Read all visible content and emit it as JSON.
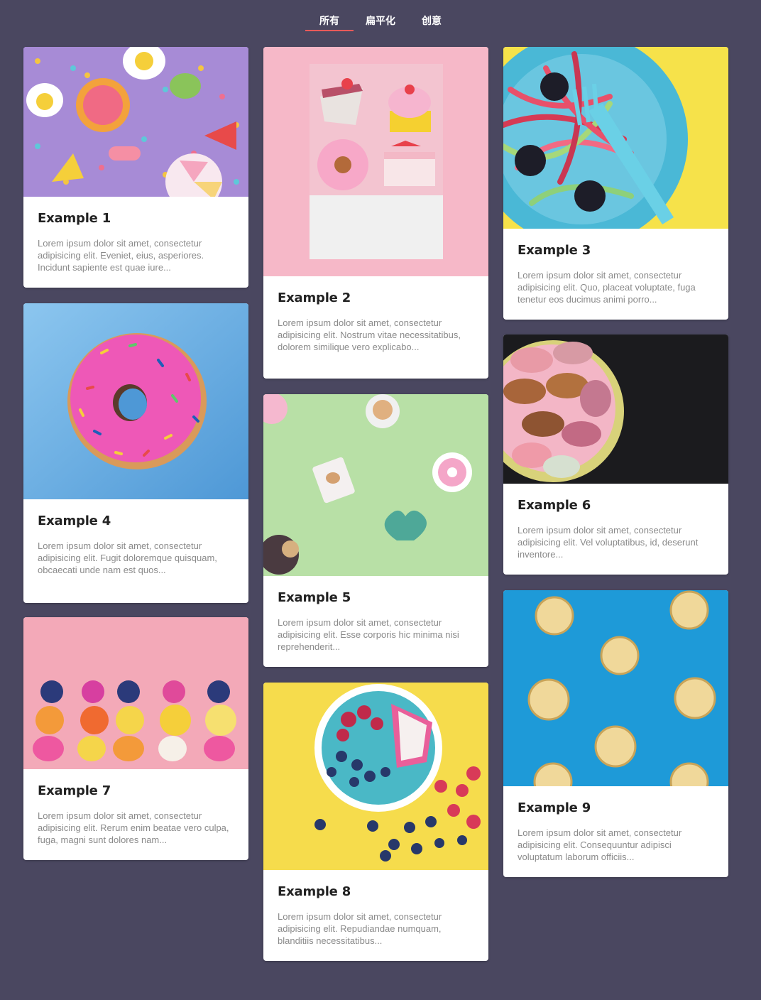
{
  "tabs": [
    {
      "label": "所有",
      "active": true
    },
    {
      "label": "扁平化",
      "active": false
    },
    {
      "label": "创意",
      "active": false
    }
  ],
  "cards": [
    {
      "title": "Example 1",
      "text": "Lorem ipsum dolor sit amet, consectetur adipisicing elit. Eveniet, eius, asperiores. Incidunt sapiente est quae iure..."
    },
    {
      "title": "Example 2",
      "text": "Lorem ipsum dolor sit amet, consectetur adipisicing elit. Nostrum vitae necessitatibus, dolorem similique vero explicabo..."
    },
    {
      "title": "Example 3",
      "text": "Lorem ipsum dolor sit amet, consectetur adipisicing elit. Quo, placeat voluptate, fuga tenetur eos ducimus animi porro..."
    },
    {
      "title": "Example 4",
      "text": "Lorem ipsum dolor sit amet, consectetur adipisicing elit. Fugit doloremque quisquam, obcaecati unde nam est quos..."
    },
    {
      "title": "Example 5",
      "text": "Lorem ipsum dolor sit amet, consectetur adipisicing elit. Esse corporis hic minima nisi reprehenderit..."
    },
    {
      "title": "Example 6",
      "text": "Lorem ipsum dolor sit amet, consectetur adipisicing elit. Vel voluptatibus, id, deserunt inventore..."
    },
    {
      "title": "Example 7",
      "text": "Lorem ipsum dolor sit amet, consectetur adipisicing elit. Rerum enim beatae vero culpa, fuga, magni sunt dolores nam..."
    },
    {
      "title": "Example 8",
      "text": "Lorem ipsum dolor sit amet, consectetur adipisicing elit. Repudiandae numquam, blanditiis necessitatibus..."
    },
    {
      "title": "Example 9",
      "text": "Lorem ipsum dolor sit amet, consectetur adipisicing elit. Consequuntur adipisci voluptatum laborum officiis..."
    }
  ],
  "colors": {
    "background": "#4a4760",
    "tab_underline": "#e85a5a",
    "card_bg": "#ffffff"
  }
}
